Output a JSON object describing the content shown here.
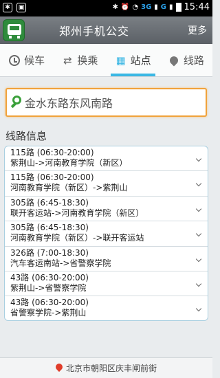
{
  "status_bar": {
    "network_3g": "3G",
    "network_g": "G",
    "time": "15:44"
  },
  "header": {
    "title": "郑州手机公交",
    "more_label": "更多"
  },
  "tabs": [
    {
      "label": "候车",
      "icon": "clock-icon"
    },
    {
      "label": "换乘",
      "icon": "transfer-icon"
    },
    {
      "label": "站点",
      "icon": "station-icon",
      "active": true
    },
    {
      "label": "线路",
      "icon": "location-pin-icon"
    }
  ],
  "search": {
    "value": "金水东路东风南路"
  },
  "section_title": "线路信息",
  "routes": [
    {
      "name": "115路 (06:30-20:00)",
      "direction": "紫荆山->河南教育学院（新区）"
    },
    {
      "name": "115路 (06:30-20:00)",
      "direction": "河南教育学院（新区）->紫荆山"
    },
    {
      "name": "305路 (6:45-18:30)",
      "direction": "联开客运站->河南教育学院（新区）"
    },
    {
      "name": "305路 (6:45-18:30)",
      "direction": "河南教育学院（新区）->联开客运站"
    },
    {
      "name": "326路 (7:00-18:30)",
      "direction": "汽车客运南站->省警察学院"
    },
    {
      "name": "43路 (06:30-20:00)",
      "direction": "紫荆山->省警察学院"
    },
    {
      "name": "43路 (06:30-20:00)",
      "direction": "省警察学院->紫荆山"
    }
  ],
  "footer": {
    "location_text": "北京市朝阳区庆丰闸前街"
  },
  "colors": {
    "accent": "#3ab7e4",
    "search_border": "#f0a23a",
    "search_icon": "#3aa03a",
    "footer_pin": "#e03c2a"
  }
}
